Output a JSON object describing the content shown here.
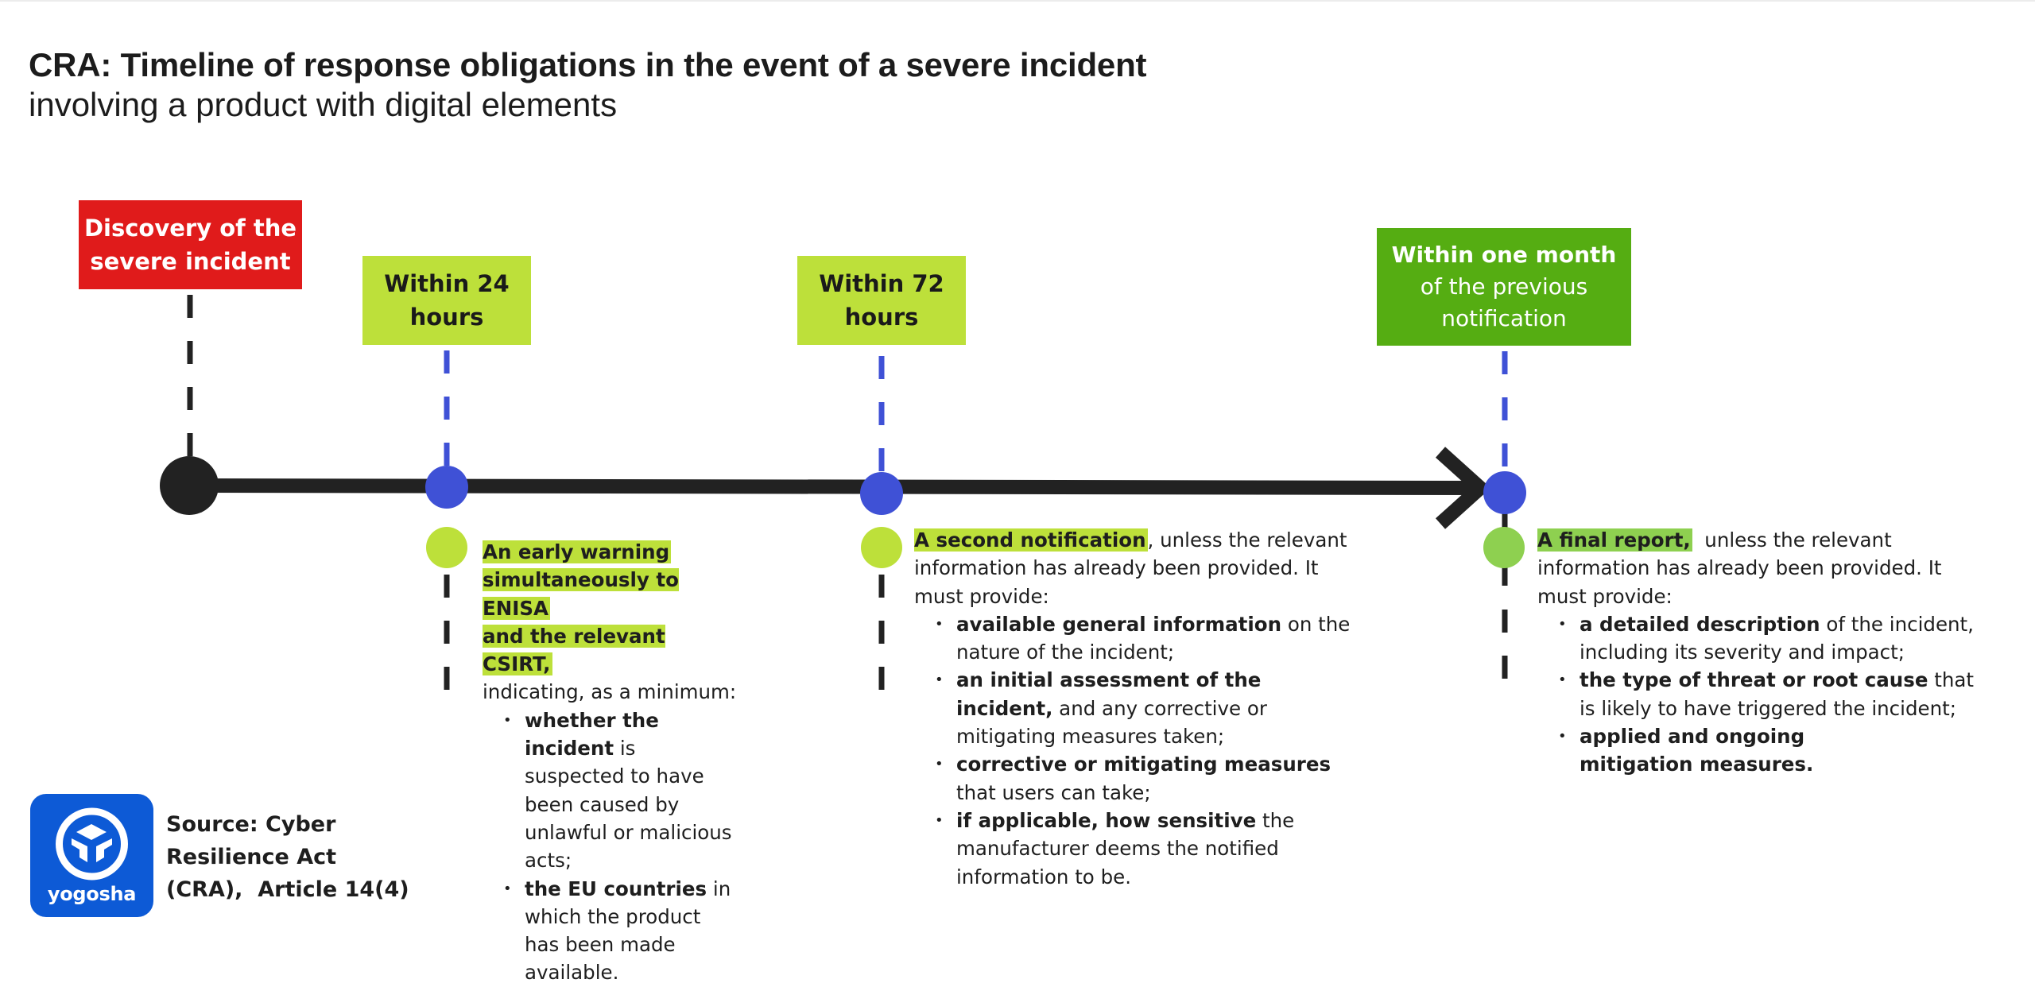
{
  "header": {
    "title": "CRA: Timeline of response obligations in the event of a severe incident",
    "subtitle": "involving a product with digital elements"
  },
  "colors": {
    "discovery": "#e01b1b",
    "stage_light_green": "#bde03a",
    "stage_dark_green": "#55ad12",
    "final_highlight": "#8ed050",
    "milestone_blue": "#3f51d6",
    "timeline_black": "#222222",
    "logo_blue": "#0d5ad6"
  },
  "stages": {
    "discovery": {
      "line1": "Discovery of the",
      "line2": "severe incident"
    },
    "h24": {
      "line1": "Within 24",
      "line2": "hours"
    },
    "h72": {
      "line1": "Within 72",
      "line2": "hours"
    },
    "month": {
      "line1": "Within one month",
      "line2": "of the previous",
      "line3": "notification"
    }
  },
  "obligations": {
    "early_warning": {
      "headline_1": "An early warning",
      "headline_2": "simultaneously to ENISA",
      "headline_3": "and the relevant CSIRT,",
      "intro": "indicating, as a minimum:",
      "bullets": [
        {
          "bold": "whether the incident",
          "text": " is suspected to have been caused by unlawful or malicious acts;"
        },
        {
          "bold": "the EU countries",
          "text": " in which the product has been made available."
        }
      ]
    },
    "second_notification": {
      "headline": "A second notification",
      "intro": ", unless the relevant information has already been provided. It must provide:",
      "bullets": [
        {
          "bold": "available general information",
          "text": " on the nature of the incident;"
        },
        {
          "bold": "an initial assessment of the incident,",
          "text": " and any corrective or mitigating measures taken;"
        },
        {
          "bold": "corrective or mitigating measures",
          "text": " that users can take;"
        },
        {
          "bold": "if applicable, how sensitive",
          "text": " the manufacturer deems the notified information to be."
        }
      ]
    },
    "final_report": {
      "headline": "A final report,",
      "intro": "  unless the relevant information has already been provided. It must provide:",
      "bullets": [
        {
          "bold": "a detailed description",
          "text": " of the incident, including its severity and impact;"
        },
        {
          "bold": "the type of threat or root cause",
          "text": " that is likely to have triggered the incident;"
        },
        {
          "bold": "applied and ongoing mitigation measures.",
          "text": ""
        }
      ]
    }
  },
  "footer": {
    "logo_text": "yogosha",
    "logo_icon": "yogosha-shield-icon",
    "source_line1": "Source: Cyber",
    "source_line2": "Resilience Act",
    "source_line3": "(CRA),  Article 14(4)"
  }
}
